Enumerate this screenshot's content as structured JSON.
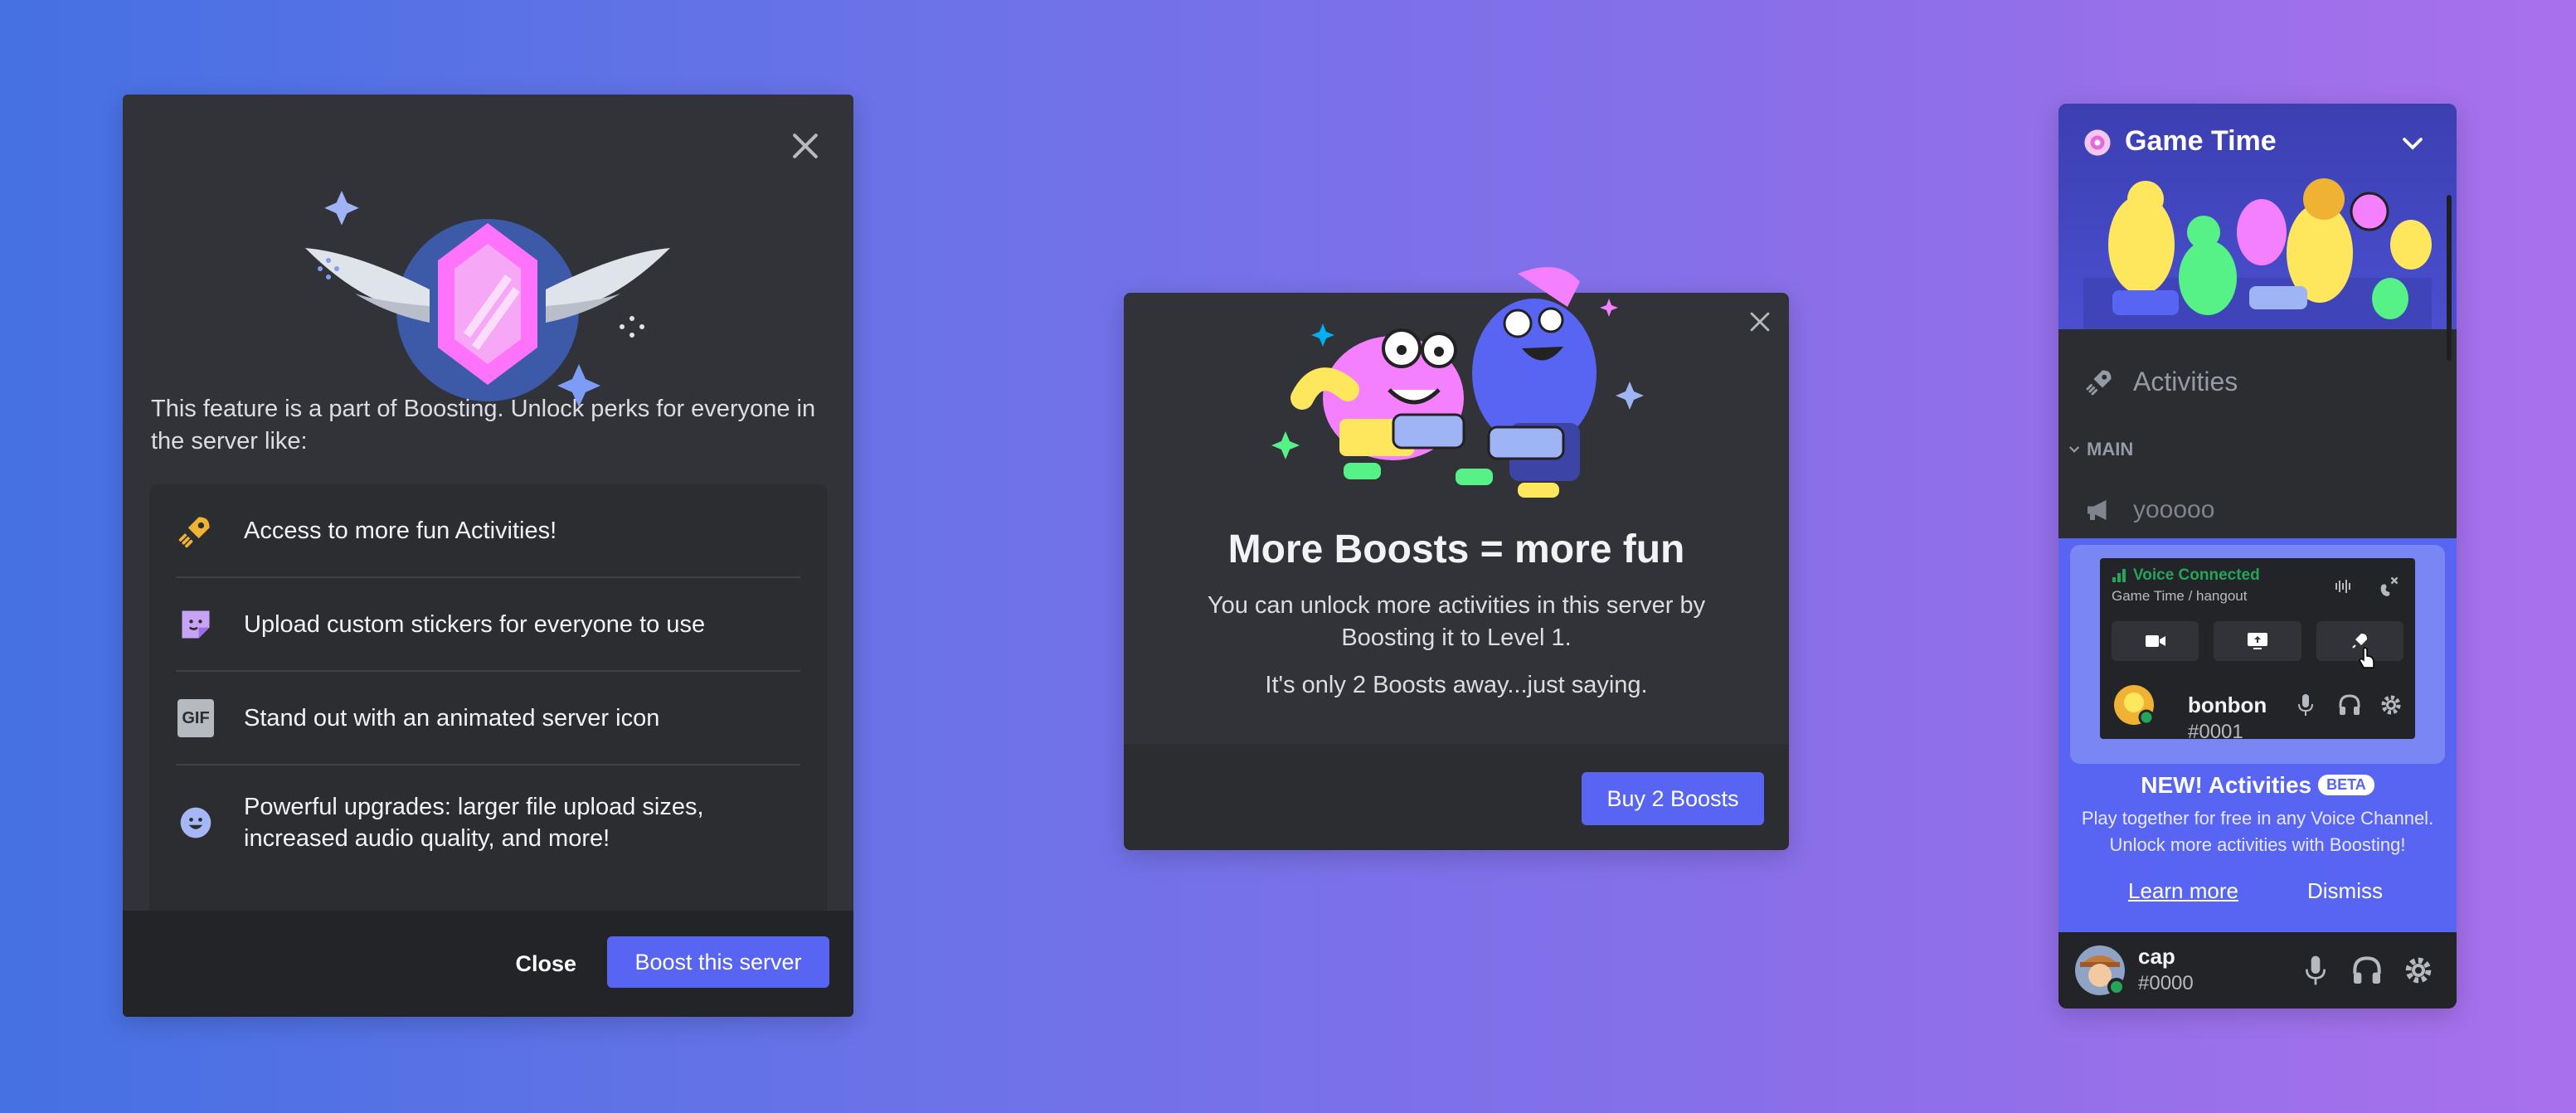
{
  "modal_boost_info": {
    "intro": "This feature is a part of Boosting. Unlock perks for everyone in the server like:",
    "perks": [
      {
        "icon": "rocket-icon",
        "text": "Access to more fun Activities!"
      },
      {
        "icon": "sticker-icon",
        "text": "Upload custom stickers for everyone to use"
      },
      {
        "icon": "gif-icon",
        "text": "Stand out with an animated server icon"
      },
      {
        "icon": "smile-icon",
        "text": "Powerful upgrades: larger file upload sizes, increased audio quality, and more!"
      }
    ],
    "gif_label": "GIF",
    "close_label": "Close",
    "boost_label": "Boost this server"
  },
  "modal_more_boosts": {
    "title": "More Boosts = more fun",
    "description": "You can unlock more activities in this server by Boosting it to Level 1.",
    "subtext": "It's only 2 Boosts away...just saying.",
    "buy_label": "Buy 2 Boosts"
  },
  "sidebar": {
    "server_name": "Game Time",
    "activities_label": "Activities",
    "category": "MAIN",
    "channel": "yooooo",
    "mini": {
      "status": "Voice Connected",
      "location": "Game Time / hangout",
      "user_name": "bonbon",
      "user_tag": "#0001"
    },
    "promo": {
      "title": "NEW! Activities",
      "badge": "BETA",
      "description": "Play together for free in any Voice Channel. Unlock more activities with Boosting!",
      "learn_more": "Learn more",
      "dismiss": "Dismiss"
    },
    "user": {
      "name": "cap",
      "tag": "#0000"
    }
  },
  "colors": {
    "blurple": "#5865f2",
    "modal_bg": "#313338",
    "footer_bg": "#232428",
    "green": "#23a55a"
  }
}
